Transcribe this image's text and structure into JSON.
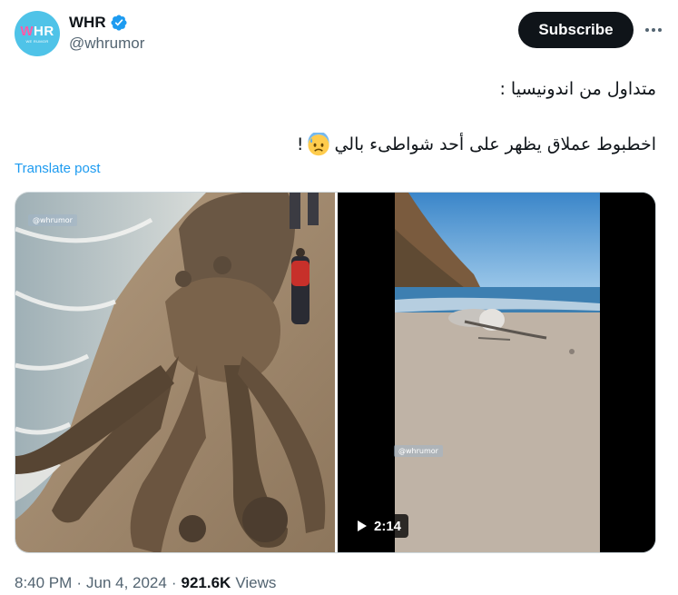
{
  "account": {
    "avatar_text": "WHR",
    "avatar_tagline": "WE RUMOR",
    "display_name": "WHR",
    "handle": "@whrumor",
    "verified": true,
    "verified_icon": "verified-badge-icon",
    "verified_color": "#1d9bf0"
  },
  "actions": {
    "subscribe_label": "Subscribe",
    "more_icon": "more-dots-icon"
  },
  "tweet": {
    "line1": "متداول من اندونيسيا :",
    "line2": "اخطبوط عملاق يظهر على أحد شواطىء بالي",
    "line2_suffix": "!",
    "emoji": "anxious-face-with-sweat-icon",
    "translate_label": "Translate post"
  },
  "media": {
    "left_watermark": "@whrumor",
    "right_watermark": "@whrumor",
    "video_duration": "2:14",
    "play_icon": "play-icon"
  },
  "meta": {
    "time": "8:40 PM",
    "sep1": "·",
    "date": "Jun 4, 2024",
    "sep2": "·",
    "views_count": "921.6K",
    "views_label": "Views"
  },
  "colors": {
    "accent": "#1d9bf0",
    "text": "#0f1419",
    "secondary": "#536471",
    "button_bg": "#0f1419"
  }
}
